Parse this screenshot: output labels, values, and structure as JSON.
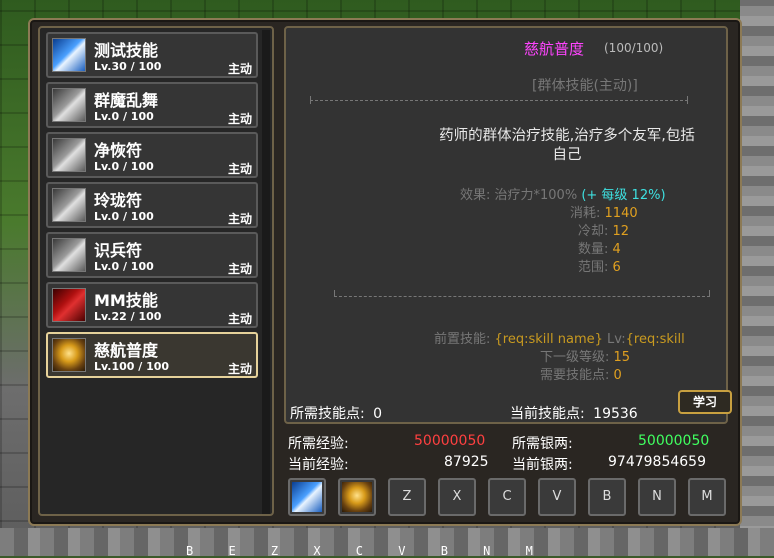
{
  "skills": [
    {
      "name": "测试技能",
      "level": "Lv.30 / 100",
      "type": "主动",
      "icon": "blue-sword-icon",
      "color": "#4aa0ff"
    },
    {
      "name": "群魔乱舞",
      "level": "Lv.0 / 100",
      "type": "主动",
      "icon": "gray-sword-icon",
      "color": "#9a9a9a"
    },
    {
      "name": "净恢符",
      "level": "Lv.0 / 100",
      "type": "主动",
      "icon": "gray-sword-icon",
      "color": "#9a9a9a"
    },
    {
      "name": "玲珑符",
      "level": "Lv.0 / 100",
      "type": "主动",
      "icon": "gray-sword-icon",
      "color": "#9a9a9a"
    },
    {
      "name": "识兵符",
      "level": "Lv.0 / 100",
      "type": "主动",
      "icon": "gray-sword-icon",
      "color": "#9a9a9a"
    },
    {
      "name": "MM技能",
      "level": "Lv.22 / 100",
      "type": "主动",
      "icon": "red-slash-icon",
      "color": "#b01010"
    },
    {
      "name": "慈航普度",
      "level": "Lv.100 / 100",
      "type": "主动",
      "icon": "golden-figure-icon",
      "color": "#d89b1a"
    }
  ],
  "detail": {
    "name": "慈航普度",
    "level": "(100/100)",
    "type": "[群体技能(主动)]",
    "description": "药师的群体治疗技能,治疗多个友军,包括自己",
    "effect_label": "效果: 治疗力*100%",
    "effect_bonus": "(+ 每级 12%)",
    "cost_label": "消耗:",
    "cost_value": "1140",
    "cooldown_label": "冷却:",
    "cooldown_value": "12",
    "count_label": "数量:",
    "count_value": "4",
    "range_label": "范围:",
    "range_value": "6",
    "prereq_label": "前置技能:",
    "prereq_value": "{req:skill name}",
    "prereq_lv_label": "Lv:",
    "prereq_lv_value": "{req:skill",
    "next_level_label": "下一级等级:",
    "next_level_value": "15",
    "points_needed_label": "需要技能点:",
    "points_needed_value": "0"
  },
  "footer": {
    "req_points_label": "所需技能点:",
    "req_points_value": "0",
    "cur_points_label": "当前技能点:",
    "cur_points_value": "19536",
    "learn_button": "学习",
    "req_exp_label": "所需经验:",
    "req_exp_value": "50000050",
    "cur_exp_label": "当前经验:",
    "cur_exp_value": "87925",
    "req_silver_label": "所需银两:",
    "req_silver_value": "50000050",
    "cur_silver_label": "当前银两:",
    "cur_silver_value": "97479854659"
  },
  "hotbar": {
    "slot_keys": [
      "Z",
      "X",
      "C",
      "V",
      "B",
      "N",
      "M"
    ]
  },
  "bottom_keys": "B E Z X C V B N M",
  "colors": {
    "skill_name_accent": "#ff44ff",
    "required_exp": "#ff4040",
    "required_silver": "#40ff60",
    "selected_border": "#e6d29a"
  }
}
